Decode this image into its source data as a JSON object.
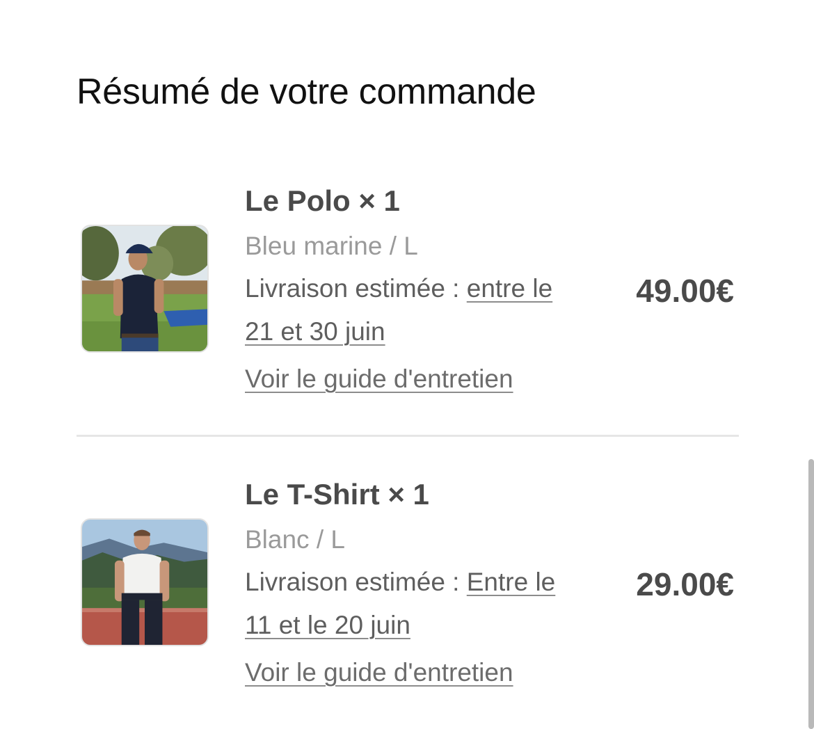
{
  "page": {
    "title": "Résumé de votre commande"
  },
  "items": [
    {
      "name": "Le Polo × 1",
      "variant": "Bleu marine / L",
      "delivery_prefix": "Livraison estimée : ",
      "delivery_link": "entre le 21 et 30 juin",
      "care_link": "Voir le guide d'entretien",
      "price": "49.00€",
      "thumbnail": "polo-photo-icon"
    },
    {
      "name": "Le T-Shirt × 1",
      "variant": "Blanc / L",
      "delivery_prefix": "Livraison estimée : ",
      "delivery_link": "Entre le 11 et le 20 juin",
      "care_link": "Voir le guide d'entretien",
      "price": "29.00€",
      "thumbnail": "tshirt-photo-icon"
    }
  ],
  "colors": {
    "text_primary": "#111111",
    "text_product": "#4a4a4a",
    "text_muted": "#9a9a9a",
    "divider": "#e6e6e6"
  }
}
